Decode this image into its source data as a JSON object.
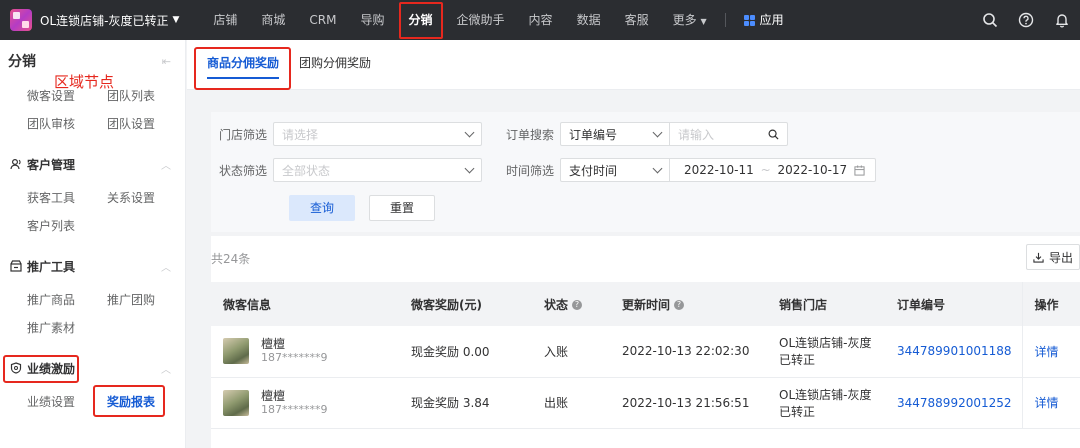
{
  "topbar": {
    "shop_name": "OL连锁店铺-灰度已转正",
    "nav": [
      "店铺",
      "商城",
      "CRM",
      "导购",
      "分销",
      "企微助手",
      "内容",
      "数据",
      "客服",
      "更多"
    ],
    "active_nav": "分销",
    "app_label": "应用",
    "icons": [
      "search-icon",
      "help-icon",
      "bell-icon"
    ]
  },
  "annotation": {
    "text": "区域节点"
  },
  "sidebar": {
    "title": "分销",
    "group1": [
      "微客设置",
      "团队列表",
      "团队审核",
      "团队设置"
    ],
    "sections": [
      {
        "title": "客户管理",
        "icon": "user-icon",
        "items": [
          "获客工具",
          "关系设置",
          "客户列表"
        ]
      },
      {
        "title": "推广工具",
        "icon": "store-icon",
        "items": [
          "推广商品",
          "推广团购",
          "推广素材"
        ]
      },
      {
        "title": "业绩激励",
        "icon": "badge-icon",
        "items": [
          "业绩设置",
          "奖励报表"
        ]
      }
    ],
    "active_item": "奖励报表"
  },
  "tabs": [
    "商品分佣奖励",
    "团购分佣奖励"
  ],
  "filters": {
    "store_label": "门店筛选",
    "store_placeholder": "请选择",
    "status_label": "状态筛选",
    "status_placeholder": "全部状态",
    "order_label": "订单搜索",
    "order_type": "订单编号",
    "order_placeholder": "请输入",
    "time_label": "时间筛选",
    "time_type": "支付时间",
    "date_start": "2022-10-11",
    "date_sep": "~",
    "date_end": "2022-10-17",
    "query_button": "查询",
    "reset_button": "重置"
  },
  "list": {
    "count": "共24条",
    "export_label": "导出",
    "columns": [
      "微客信息",
      "微客奖励(元)",
      "状态",
      "更新时间",
      "销售门店",
      "订单编号",
      "操作"
    ],
    "rows": [
      {
        "name": "檀檀",
        "phone": "187*******9",
        "reward": "现金奖励 0.00",
        "status": "入账",
        "time": "2022-10-13 22:02:30",
        "store_l1": "OL连锁店铺-灰度",
        "store_l2": "已转正",
        "order": "344789901001188",
        "action": "详情"
      },
      {
        "name": "檀檀",
        "phone": "187*******9",
        "reward": "现金奖励 3.84",
        "status": "出账",
        "time": "2022-10-13 21:56:51",
        "store_l1": "OL连锁店铺-灰度",
        "store_l2": "已转正",
        "order": "344788992001252",
        "action": "详情"
      }
    ]
  },
  "colors": {
    "topbar": "#2b2d31",
    "accent": "#155bd4",
    "highlight": "#e6281e"
  }
}
